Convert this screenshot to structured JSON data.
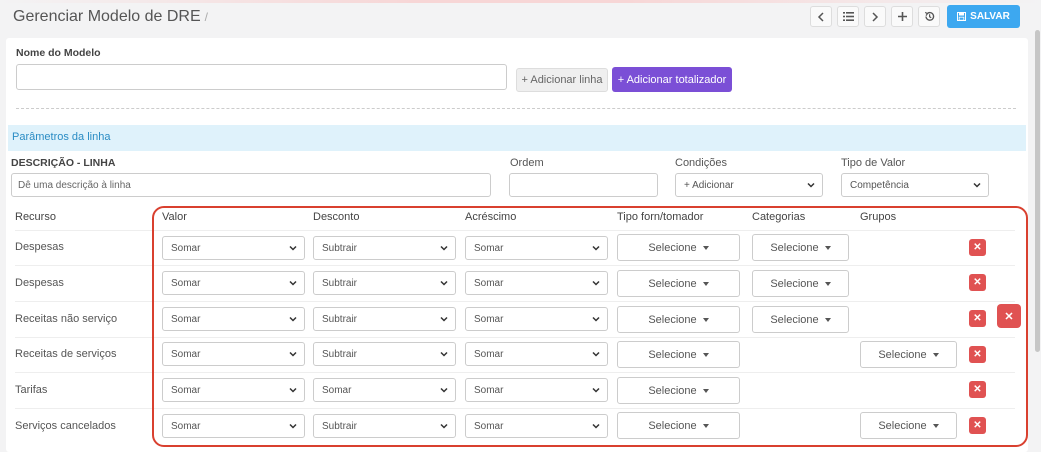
{
  "header": {
    "title": "Gerenciar Modelo de DRE",
    "separator": "/",
    "save_label": "SALVAR"
  },
  "model": {
    "name_label": "Nome do Modelo",
    "name_value": "",
    "add_line_label": "+ Adicionar linha",
    "add_total_label": "+ Adicionar totalizador"
  },
  "params": {
    "section_title": "Parâmetros da linha",
    "desc_label": "DESCRIÇÃO - LINHA",
    "desc_placeholder": "Dê uma descrição à linha",
    "order_label": "Ordem",
    "conditions_label": "Condições",
    "conditions_value": "+ Adicionar",
    "value_type_label": "Tipo de Valor",
    "value_type_value": "Competência"
  },
  "table": {
    "headers": {
      "recurso": "Recurso",
      "valor": "Valor",
      "desconto": "Desconto",
      "acrescimo": "Acréscimo",
      "tipo": "Tipo forn/tomador",
      "categorias": "Categorias",
      "grupos": "Grupos"
    },
    "select_placeholder": "Selecione",
    "rows": [
      {
        "recurso": "Despesas",
        "valor": "Somar",
        "desconto": "Subtrair",
        "acrescimo": "Somar"
      },
      {
        "recurso": "Despesas",
        "valor": "Somar",
        "desconto": "Subtrair",
        "acrescimo": "Somar"
      },
      {
        "recurso": "Receitas não serviço",
        "valor": "Somar",
        "desconto": "Subtrair",
        "acrescimo": "Somar"
      },
      {
        "recurso": "Receitas de serviços",
        "valor": "Somar",
        "desconto": "Subtrair",
        "acrescimo": "Somar"
      },
      {
        "recurso": "Tarifas",
        "valor": "Somar",
        "desconto": "Somar",
        "acrescimo": "Somar"
      },
      {
        "recurso": "Serviços cancelados",
        "valor": "Somar",
        "desconto": "Subtrair",
        "acrescimo": "Somar"
      }
    ],
    "delete_glyph": "✕"
  }
}
